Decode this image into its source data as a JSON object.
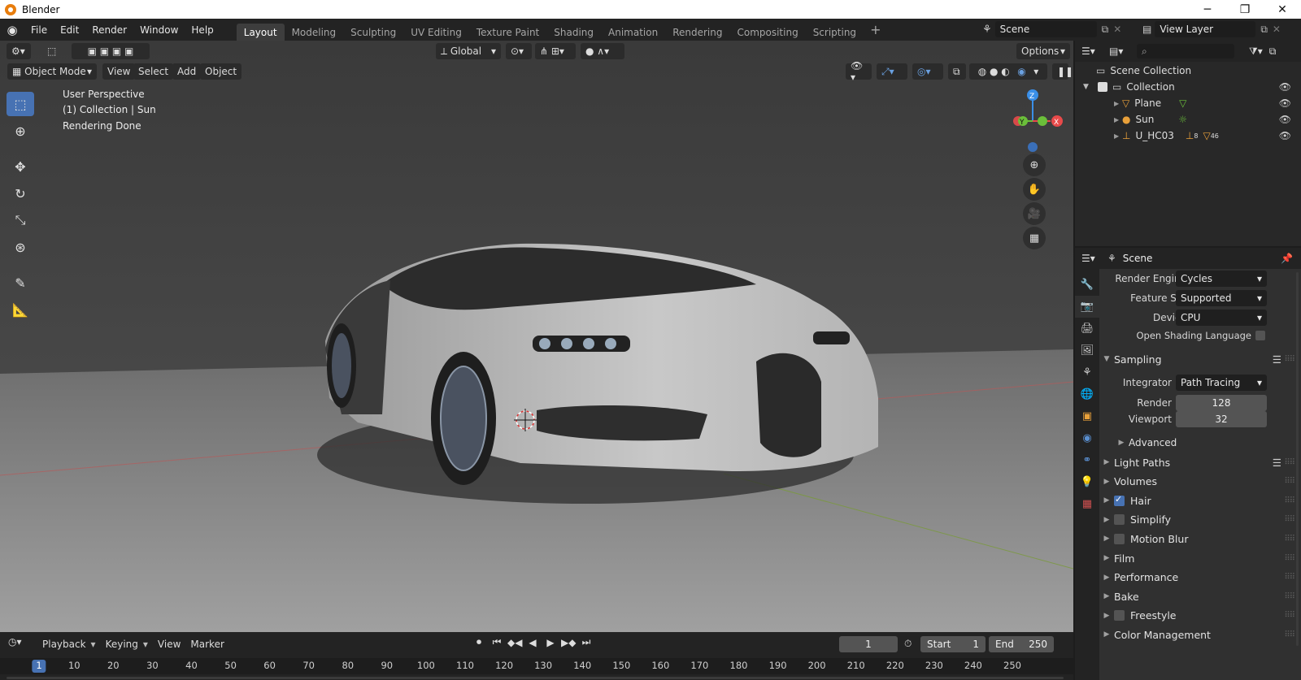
{
  "window": {
    "title": "Blender",
    "minimize": "─",
    "maximize": "❐",
    "close": "✕"
  },
  "menu": [
    "File",
    "Edit",
    "Render",
    "Window",
    "Help"
  ],
  "workspaces": [
    "Layout",
    "Modeling",
    "Sculpting",
    "UV Editing",
    "Texture Paint",
    "Shading",
    "Animation",
    "Rendering",
    "Compositing",
    "Scripting"
  ],
  "active_workspace": "Layout",
  "scene_field": "Scene",
  "view_layer_field": "View Layer",
  "viewport": {
    "mode": "Object Mode",
    "menus": [
      "View",
      "Select",
      "Add",
      "Object"
    ],
    "transform_orientation": "Global",
    "options": "Options",
    "overlay": {
      "perspective": "User Perspective",
      "collection": "(1) Collection | Sun",
      "status": "Rendering Done"
    },
    "gizmo": {
      "z": "Z",
      "y": "Y",
      "x": "X"
    }
  },
  "timeline": {
    "menus": [
      "Playback",
      "Keying",
      "View",
      "Marker"
    ],
    "current_frame": "1",
    "start_label": "Start",
    "start": "1",
    "end_label": "End",
    "end": "250",
    "ruler": [
      "1",
      "10",
      "20",
      "30",
      "40",
      "50",
      "60",
      "70",
      "80",
      "90",
      "100",
      "110",
      "120",
      "130",
      "140",
      "150",
      "160",
      "170",
      "180",
      "190",
      "200",
      "210",
      "220",
      "230",
      "240",
      "250"
    ]
  },
  "outliner": {
    "root": "Scene Collection",
    "collection": "Collection",
    "items": [
      {
        "name": "Plane"
      },
      {
        "name": "Sun"
      },
      {
        "name": "U_HC03",
        "badge1": "8",
        "badge2": "46"
      }
    ]
  },
  "properties": {
    "header": "Scene",
    "render_engine": {
      "label": "Render Engine",
      "value": "Cycles"
    },
    "feature_set": {
      "label": "Feature Set",
      "value": "Supported"
    },
    "device": {
      "label": "Device",
      "value": "CPU"
    },
    "osl": {
      "label": "Open Shading Language"
    },
    "sampling": {
      "title": "Sampling",
      "integrator": {
        "label": "Integrator",
        "value": "Path Tracing"
      },
      "render": {
        "label": "Render",
        "value": "128"
      },
      "viewport": {
        "label": "Viewport",
        "value": "32"
      },
      "advanced": "Advanced"
    },
    "panels": [
      {
        "label": "Light Paths",
        "checkbox": null
      },
      {
        "label": "Volumes",
        "checkbox": null
      },
      {
        "label": "Hair",
        "checkbox": true
      },
      {
        "label": "Simplify",
        "checkbox": false
      },
      {
        "label": "Motion Blur",
        "checkbox": false
      },
      {
        "label": "Film",
        "checkbox": null
      },
      {
        "label": "Performance",
        "checkbox": null
      },
      {
        "label": "Bake",
        "checkbox": null
      },
      {
        "label": "Freestyle",
        "checkbox": false
      },
      {
        "label": "Color Management",
        "checkbox": null
      }
    ]
  },
  "colors": {
    "accent": "#4772b3",
    "orange": "#e8a03a",
    "gizmo_x": "#e84a4a",
    "gizmo_y": "#6bbf3a",
    "gizmo_z": "#3a8fe8"
  }
}
